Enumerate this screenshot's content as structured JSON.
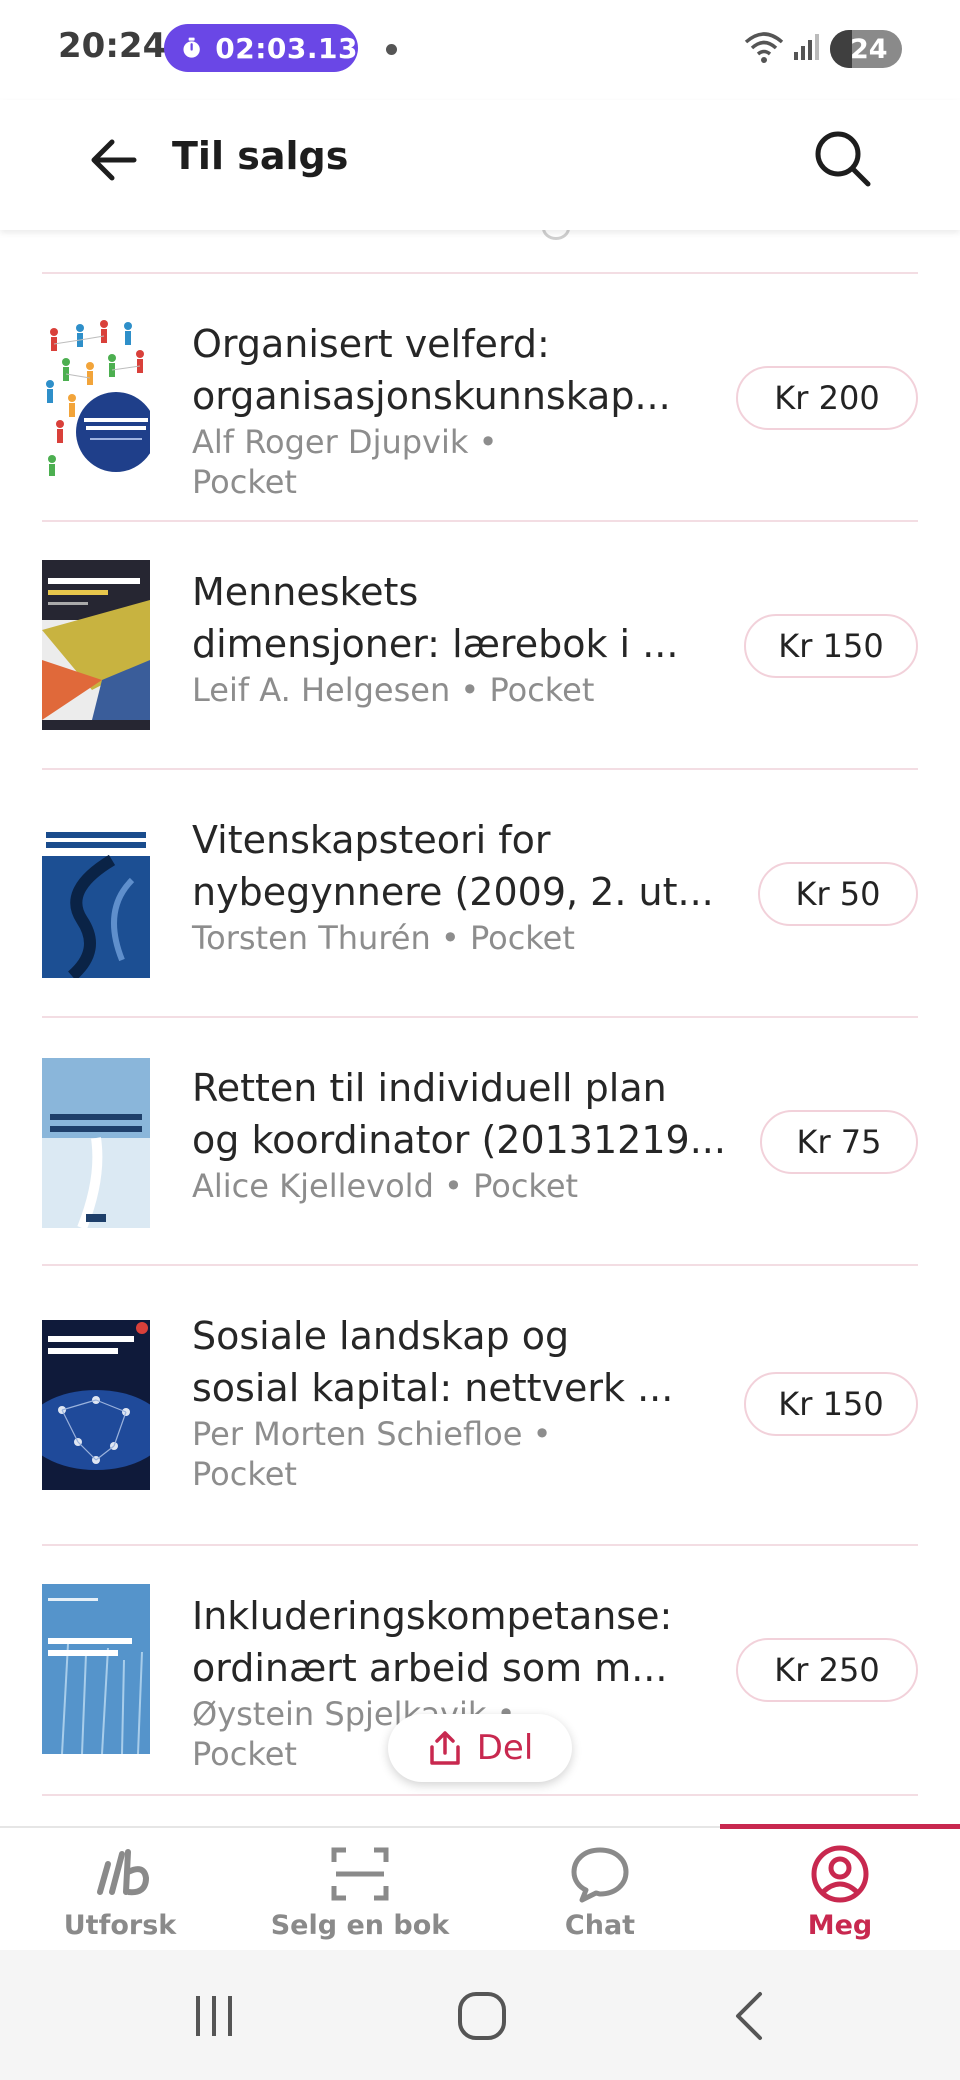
{
  "status_bar": {
    "time": "20:24",
    "timer": "02:03.13",
    "battery": "24"
  },
  "app_bar": {
    "title": "Til salgs"
  },
  "books": [
    {
      "title_line1": "Organisert velferd:",
      "title_line2": "organisasjonskunnskap...",
      "meta_line1": "Alf Roger Djupvik • Pocket",
      "meta_line2": "",
      "price": "Kr 200"
    },
    {
      "title_line1": "Menneskets",
      "title_line2": "dimensjoner: lærebok i ...",
      "meta_line1": "Leif A. Helgesen • Pocket",
      "meta_line2": "",
      "price": "Kr 150"
    },
    {
      "title_line1": "Vitenskapsteori for",
      "title_line2": "nybegynnere (2009, 2. ut...",
      "meta_line1": "Torsten Thurén • Pocket",
      "meta_line2": "",
      "price": "Kr 50"
    },
    {
      "title_line1": "Retten til individuell plan",
      "title_line2": "og koordinator (20131219...",
      "meta_line1": "Alice Kjellevold • Pocket",
      "meta_line2": "",
      "price": "Kr 75"
    },
    {
      "title_line1": "Sosiale landskap og",
      "title_line2": "sosial kapital: nettverk ...",
      "meta_line1": "Per Morten Schiefloe •",
      "meta_line2": "Pocket",
      "price": "Kr 150"
    },
    {
      "title_line1": "Inkluderingskompetanse:",
      "title_line2": "ordinært arbeid som m...",
      "meta_line1": "Øystein Spjelkavik • Pocket",
      "meta_line2": "",
      "price": "Kr 250"
    }
  ],
  "share": {
    "label": "Del"
  },
  "nav": {
    "items": [
      {
        "label": "Utforsk",
        "icon": "ib-logo-icon"
      },
      {
        "label": "Selg en bok",
        "icon": "scan-frame-icon"
      },
      {
        "label": "Chat",
        "icon": "chat-bubble-icon"
      },
      {
        "label": "Meg",
        "icon": "profile-icon"
      }
    ],
    "active_index": 3
  },
  "colors": {
    "accent": "#c8284f",
    "timer_bg": "#6a47e6",
    "divider": "#f3dde3",
    "muted_text": "#8d8d8d"
  }
}
